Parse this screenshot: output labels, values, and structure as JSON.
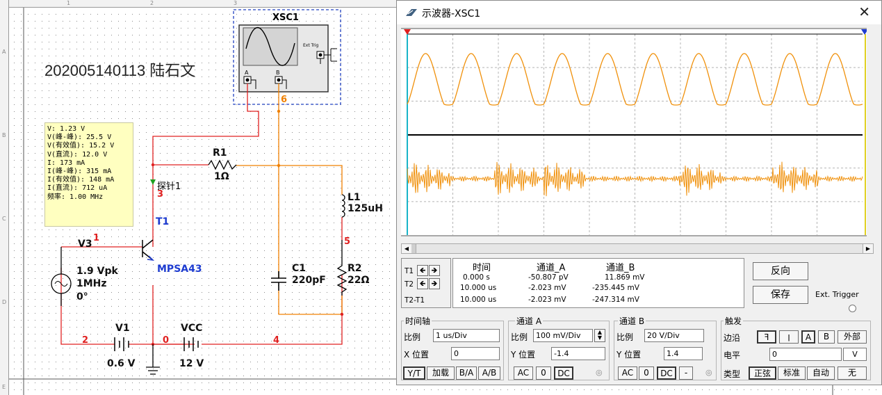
{
  "schematic": {
    "ruler_top": [
      "1",
      "2",
      "3"
    ],
    "ruler_left": [
      "A",
      "B",
      "C",
      "D",
      "E"
    ],
    "student_label": "202005140113 陆石文",
    "scope_ref": "XSC1",
    "scope_icon_labels": {
      "ext_trig": "Ext Trig",
      "a": "A",
      "b": "B"
    },
    "probe_tip": [
      "V: 1.23 V",
      "V(峰-峰): 25.5 V",
      "V(有效值): 15.2 V",
      "V(直流): 12.0 V",
      "I: 173 mA",
      "I(峰-峰): 315 mA",
      "I(有效值): 148 mA",
      "I(直流): 712 uA",
      "频率: 1.00 MHz"
    ],
    "probe_label": "探针1",
    "components": {
      "r1_name": "R1",
      "r1_value": "1Ω",
      "l1_name": "L1",
      "l1_value": "125uH",
      "c1_name": "C1",
      "c1_value": "220pF",
      "r2_name": "R2",
      "r2_value": "22Ω",
      "t1_name": "T1",
      "t1_model": "MPSA43",
      "v3_name": "V3",
      "v3_amp": "1.9 Vpk",
      "v3_freq": "1MHz",
      "v3_phase": "0°",
      "v1_name": "V1",
      "v1_value": "0.6 V",
      "vcc_name": "VCC",
      "vcc_value": "12 V"
    },
    "nodes": {
      "n1": "1",
      "n2": "2",
      "n3": "3",
      "n4": "4",
      "n5": "5",
      "n6": "6",
      "n0": "0"
    }
  },
  "scope": {
    "title": "示波器-XSC1",
    "close": "✕",
    "colors": {
      "trace": "#f0900a",
      "screen_bg": "#ffffff",
      "grid": "#b4b4b4"
    },
    "cursor_rows": [
      {
        "label": "T1"
      },
      {
        "label": "T2"
      },
      {
        "label": "T2-T1"
      }
    ],
    "readout": {
      "headers": [
        "时间",
        "通道_A",
        "通道_B"
      ],
      "rows": [
        [
          "0.000 s",
          "-50.807 pV",
          "11.869 mV"
        ],
        [
          "10.000 us",
          "-2.023 mV",
          "-235.445 mV"
        ],
        [
          "10.000 us",
          "-2.023 mV",
          "-247.314 mV"
        ]
      ]
    },
    "reverse_btn": "反向",
    "save_btn": "保存",
    "ext_trigger": "Ext. Trigger",
    "timebase": {
      "title": "时间轴",
      "scale_label": "比例",
      "scale_value": "1 us/Div",
      "xpos_label": "X 位置",
      "xpos_value": "0",
      "buttons": [
        "Y/T",
        "加载",
        "B/A",
        "A/B"
      ]
    },
    "channel_a": {
      "title": "通道 A",
      "scale_label": "比例",
      "scale_value": "100 mV/Div",
      "ypos_label": "Y 位置",
      "ypos_value": "-1.4",
      "buttons": [
        "AC",
        "0",
        "DC"
      ]
    },
    "channel_b": {
      "title": "通道 B",
      "scale_label": "比例",
      "scale_value": "20  V/Div",
      "ypos_label": "Y 位置",
      "ypos_value": "1.4",
      "buttons": [
        "AC",
        "0",
        "DC",
        "-"
      ]
    },
    "trigger": {
      "title": "触发",
      "edge_label": "边沿",
      "edge_buttons": [
        "ꟻ",
        "ꞁ",
        "A",
        "B",
        "外部"
      ],
      "level_label": "电平",
      "level_value": "0",
      "level_unit": "V",
      "type_label": "类型",
      "type_buttons": [
        "正弦",
        "标准",
        "自动",
        "无"
      ]
    }
  }
}
